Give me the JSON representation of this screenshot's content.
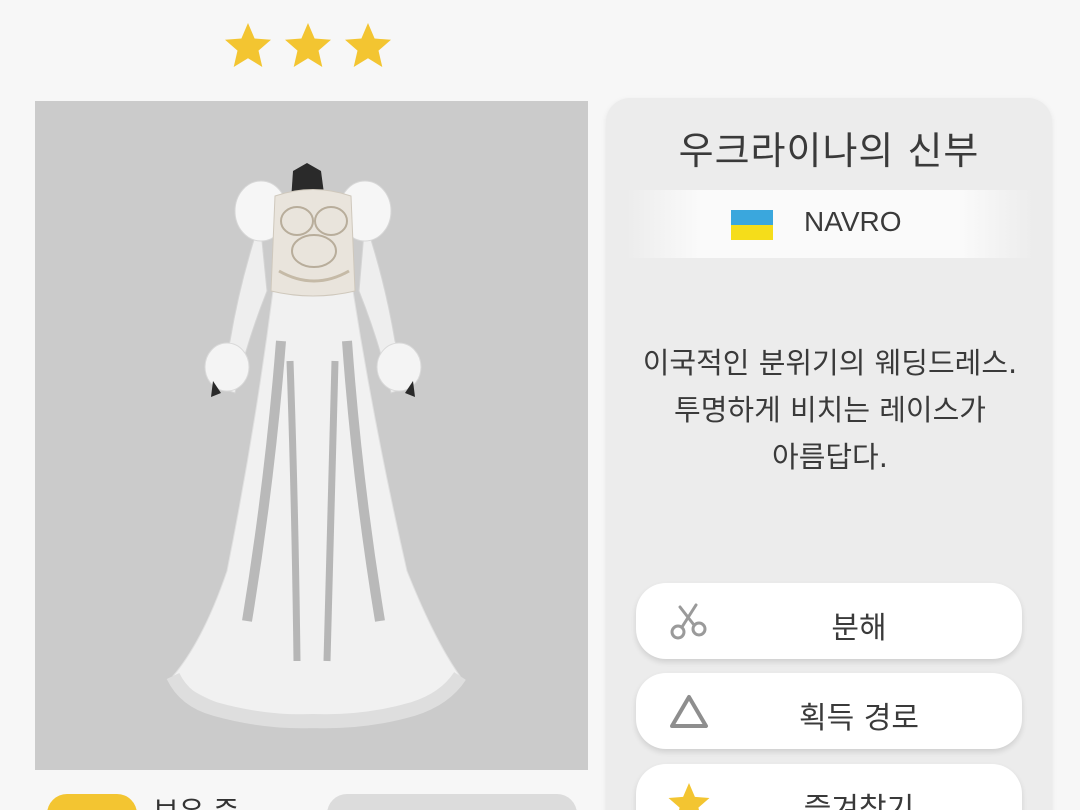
{
  "rating": {
    "stars": 3,
    "color": "#f3c531"
  },
  "item": {
    "title": "우크라이나의 신부",
    "brand": "NAVRO",
    "country_flag": {
      "icon": "ukraine-flag-icon",
      "colors": [
        "#3aa7dd",
        "#f5dd1a"
      ]
    },
    "description_lines": [
      "이국적인 분위기의 웨딩드레스.",
      "투명하게 비치는 레이스가",
      "아름답다."
    ],
    "image": "white-lace-wedding-dress"
  },
  "actions": {
    "disassemble": {
      "label": "분해",
      "icon": "scissors-icon"
    },
    "route": {
      "label": "획득 경로",
      "icon": "triangle-icon"
    },
    "favorite": {
      "label": "즐겨찾기",
      "icon": "star-icon"
    }
  },
  "owned": {
    "label": "보유 중"
  }
}
